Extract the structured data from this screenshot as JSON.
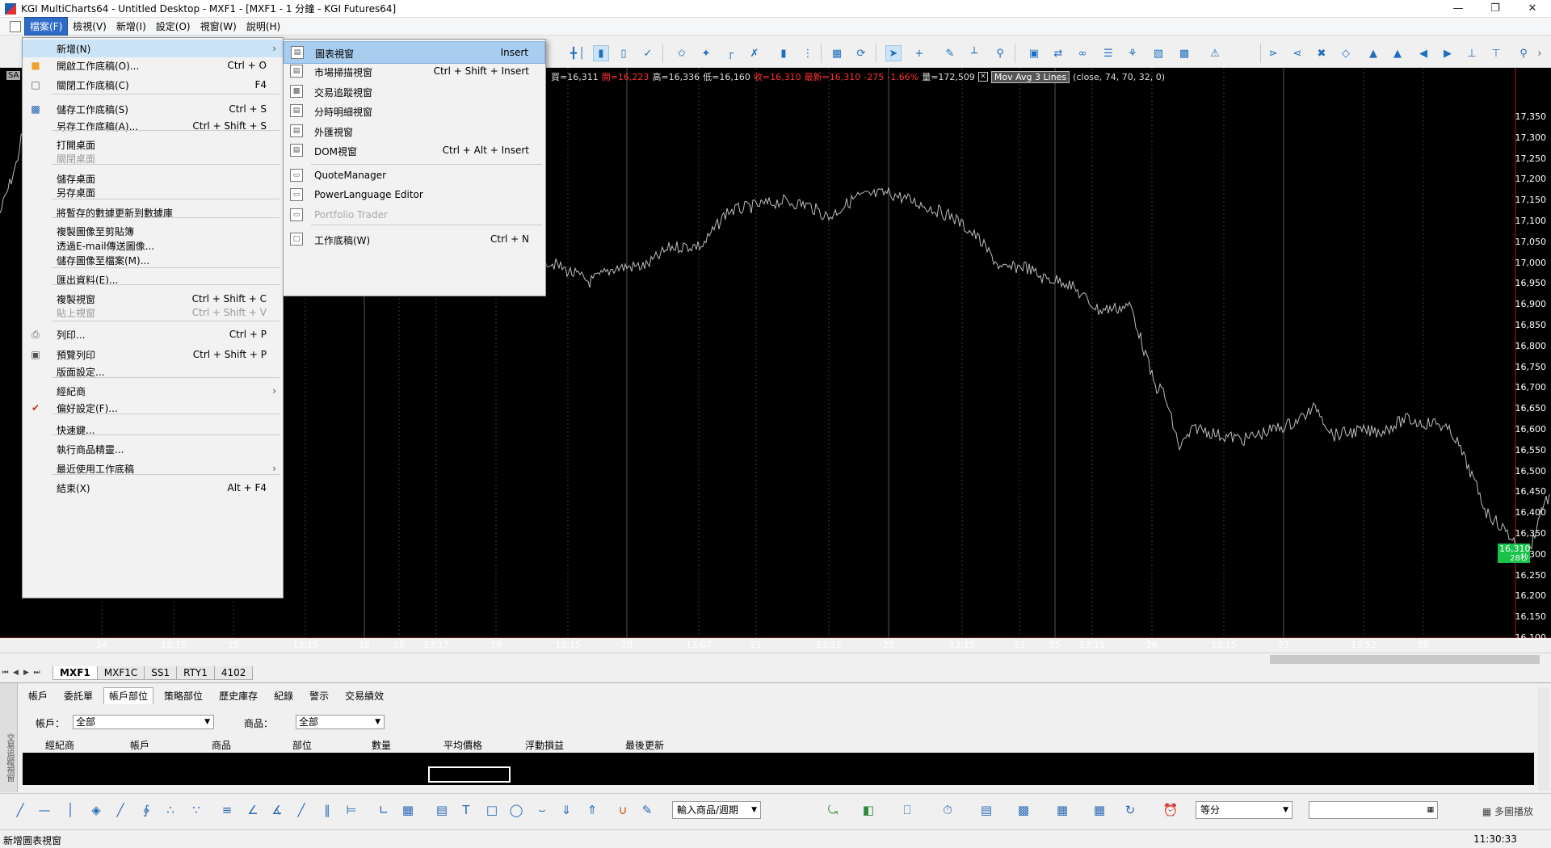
{
  "window": {
    "title": "KGI MultiCharts64 - Untitled Desktop - MXF1 - [MXF1 - 1 分鐘 - KGI Futures64]"
  },
  "menubar": {
    "items": [
      "檔案(F)",
      "檢視(V)",
      "新增(I)",
      "設定(O)",
      "視窗(W)",
      "說明(H)"
    ]
  },
  "chart": {
    "symbol_tag": "SA",
    "info": {
      "buy": "買=16,311",
      "open": "開=16,223",
      "high": "高=16,336",
      "low": "低=16,160",
      "close": "收=16,310",
      "last": "最新=16,310",
      "change": "-275",
      "change_pct": "-1.66%",
      "volume": "量=172,509",
      "indicator": "Mov Avg 3 Lines",
      "indicator_params": "(close,  74,  70,  32,  0)"
    },
    "price_axis": [
      "17,350",
      "17,300",
      "17,250",
      "17,200",
      "17,150",
      "17,100",
      "17,050",
      "17,000",
      "16,950",
      "16,900",
      "16,850",
      "16,800",
      "16,750",
      "16,700",
      "16,650",
      "16,600",
      "16,550",
      "16,500",
      "16,450",
      "16,400",
      "16,350",
      "16,300",
      "16,250",
      "16,200",
      "16,150",
      "16,100"
    ],
    "last_price": "16,310",
    "last_time": "28秒",
    "time_axis": [
      "14",
      "13:15",
      "15",
      "13:15",
      "16",
      "18",
      "13:17",
      "19",
      "13:15",
      "20",
      "13:07",
      "21",
      "13:15",
      "22",
      "13:15",
      "23",
      "25",
      "13:15",
      "26",
      "13:15",
      "27",
      "13:52",
      "28"
    ]
  },
  "sheet_tabs": [
    "MXF1",
    "MXF1C",
    "SS1",
    "RTY1",
    "4102"
  ],
  "panel": {
    "tabs": [
      "帳戶",
      "委託單",
      "帳戶部位",
      "策略部位",
      "歷史庫存",
      "紀錄",
      "警示",
      "交易績效"
    ],
    "account_label": "帳戶：",
    "account_value": "全部",
    "symbol_label": "商品：",
    "symbol_value": "全部",
    "columns": [
      "經紀商",
      "帳戶",
      "商品",
      "部位",
      "數量",
      "平均價格",
      "浮動損益",
      "最後更新"
    ],
    "sidebar_label": "交易追蹤視窗"
  },
  "drawbar": {
    "symbol_combo": "輸入商品/週期",
    "split_combo": "等分",
    "multi_play": "多圖播放"
  },
  "status": {
    "message": "新增圖表視窗",
    "clock": "11:30:33"
  },
  "file_menu": {
    "items": [
      {
        "label": "新增(N)",
        "shortcut": "",
        "submenu": true,
        "disabled": false
      },
      {
        "label": "開啟工作底稿(O)...",
        "shortcut": "Ctrl + O",
        "disabled": false
      },
      {
        "label": "關閉工作底稿(C)",
        "shortcut": "F4",
        "disabled": false
      },
      {
        "label": "儲存工作底稿(S)",
        "shortcut": "Ctrl + S",
        "disabled": false
      },
      {
        "label": "另存工作底稿(A)...",
        "shortcut": "Ctrl + Shift + S",
        "disabled": false
      },
      {
        "label": "打開桌面",
        "shortcut": "",
        "disabled": false
      },
      {
        "label": "關閉桌面",
        "shortcut": "",
        "disabled": true
      },
      {
        "label": "儲存桌面",
        "shortcut": "",
        "disabled": false
      },
      {
        "label": "另存桌面",
        "shortcut": "",
        "disabled": false
      },
      {
        "label": "將暫存的數據更新到數據庫",
        "shortcut": "",
        "disabled": false
      },
      {
        "label": "複製圖像至剪貼簿",
        "shortcut": "",
        "disabled": false
      },
      {
        "label": "透過E-mail傳送圖像...",
        "shortcut": "",
        "disabled": false
      },
      {
        "label": "儲存圖像至檔案(M)...",
        "shortcut": "",
        "disabled": false
      },
      {
        "label": "匯出資料(E)...",
        "shortcut": "",
        "disabled": false
      },
      {
        "label": "複製視窗",
        "shortcut": "Ctrl + Shift + C",
        "disabled": false
      },
      {
        "label": "貼上視窗",
        "shortcut": "Ctrl + Shift + V",
        "disabled": true
      },
      {
        "label": "列印...",
        "shortcut": "Ctrl + P",
        "disabled": false
      },
      {
        "label": "預覽列印",
        "shortcut": "Ctrl + Shift + P",
        "disabled": false
      },
      {
        "label": "版面設定...",
        "shortcut": "",
        "disabled": false
      },
      {
        "label": "經紀商",
        "shortcut": "",
        "submenu": true,
        "disabled": false
      },
      {
        "label": "偏好設定(F)...",
        "shortcut": "",
        "disabled": false
      },
      {
        "label": "快速鍵...",
        "shortcut": "",
        "disabled": false
      },
      {
        "label": "執行商品精靈...",
        "shortcut": "",
        "disabled": false
      },
      {
        "label": "最近使用工作底稿",
        "shortcut": "",
        "submenu": true,
        "disabled": false
      },
      {
        "label": "結束(X)",
        "shortcut": "Alt + F4",
        "disabled": false
      }
    ]
  },
  "new_submenu": {
    "items": [
      {
        "label": "圖表視窗",
        "shortcut": "Insert",
        "disabled": false
      },
      {
        "label": "市場掃描視窗",
        "shortcut": "Ctrl + Shift + Insert",
        "disabled": false
      },
      {
        "label": "交易追蹤視窗",
        "shortcut": "",
        "disabled": false
      },
      {
        "label": "分時明細視窗",
        "shortcut": "",
        "disabled": false
      },
      {
        "label": "外匯視窗",
        "shortcut": "",
        "disabled": false
      },
      {
        "label": "DOM視窗",
        "shortcut": "Ctrl + Alt + Insert",
        "disabled": false
      },
      {
        "label": "QuoteManager",
        "shortcut": "",
        "disabled": false
      },
      {
        "label": "PowerLanguage Editor",
        "shortcut": "",
        "disabled": false
      },
      {
        "label": "Portfolio Trader",
        "shortcut": "",
        "disabled": true
      },
      {
        "label": "工作底稿(W)",
        "shortcut": "Ctrl + N",
        "disabled": false
      }
    ]
  }
}
